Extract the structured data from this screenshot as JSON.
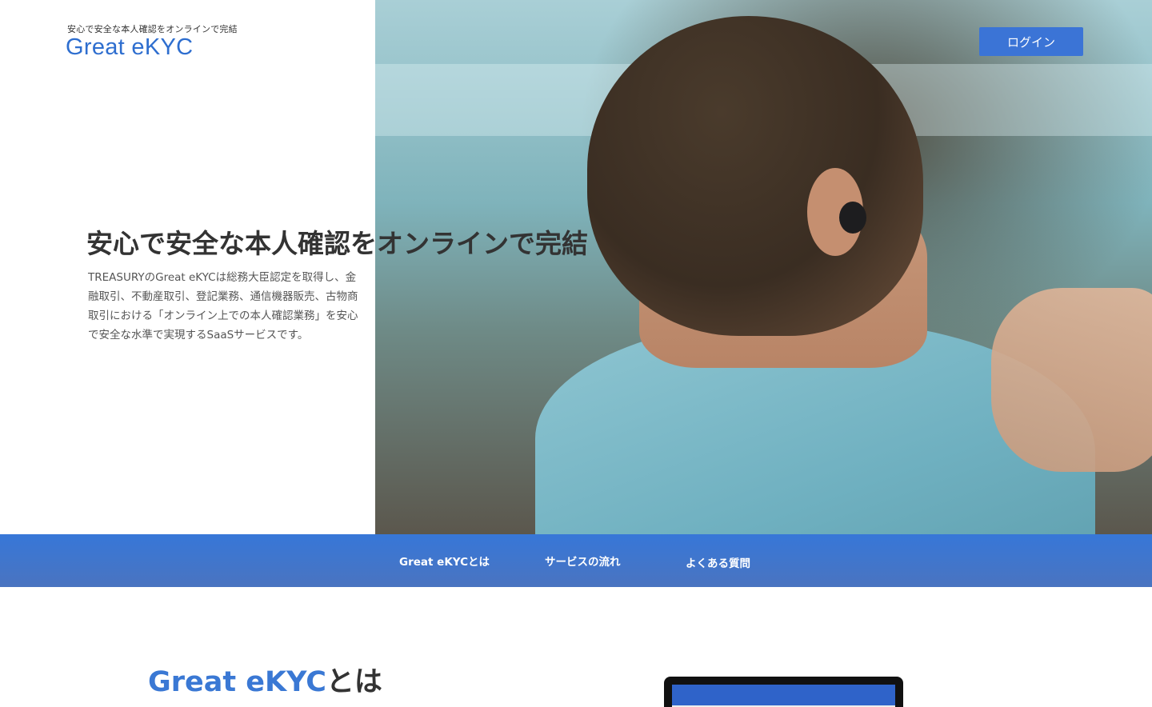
{
  "header": {
    "tagline": "安心で安全な本人確認をオンラインで完結",
    "brand": "Great eKYC",
    "login_label": "ログイン"
  },
  "hero": {
    "title": "安心で安全な本人確認をオンラインで完結",
    "description": "TREASURYのGreat eKYCは総務大臣認定を取得し、金融取引、不動産取引、登記業務、通信機器販売、古物商取引における「オンライン上での本人確認業務」を安心で安全な水準で実現するSaaSサービスです。"
  },
  "nav": {
    "items": [
      {
        "label": "Great eKYCとは"
      },
      {
        "label": "サービスの流れ"
      },
      {
        "label": "よくある質問"
      }
    ]
  },
  "section": {
    "title_accent": "Great eKYC",
    "title_rest": "とは"
  },
  "colors": {
    "accent": "#3b74d6",
    "nav_band": "#3777d8",
    "brand_text": "#2e6ecf"
  }
}
